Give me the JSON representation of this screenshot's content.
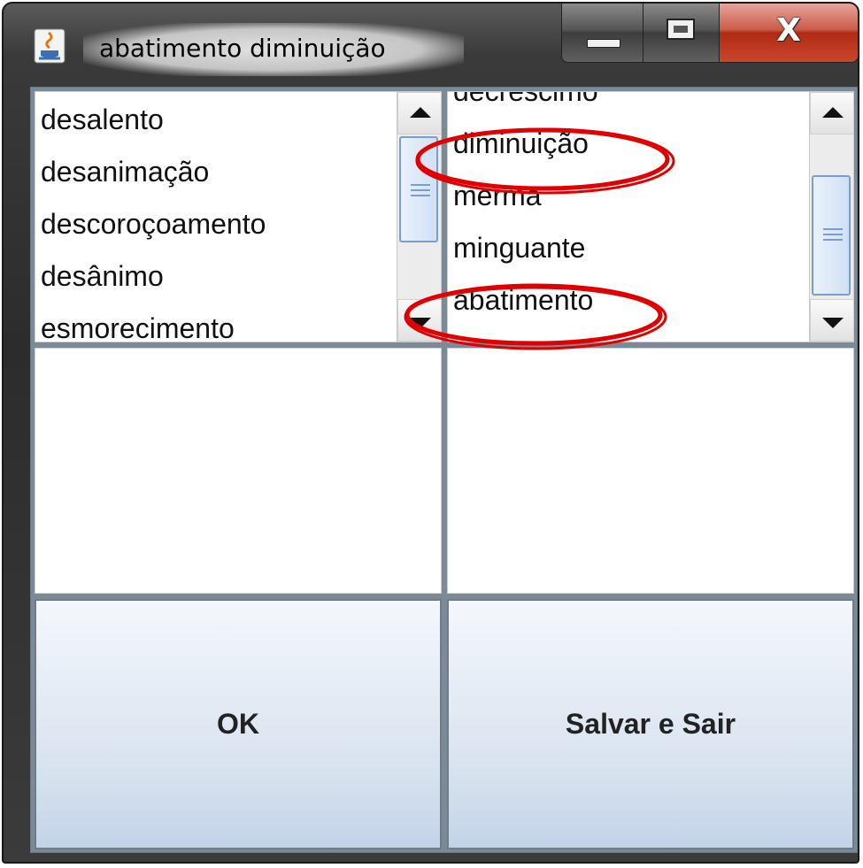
{
  "window": {
    "title": "abatimento diminuição",
    "close_label": "X"
  },
  "left_list": {
    "items": [
      "desalento",
      "desanimação",
      "descoroçoamento",
      "desânimo",
      "esmorecimento"
    ]
  },
  "right_list": {
    "items": [
      "decrescimo",
      "diminuição",
      "merma",
      "minguante",
      "abatimento"
    ],
    "highlighted": [
      "diminuição",
      "abatimento"
    ]
  },
  "buttons": {
    "ok_label": "OK",
    "save_label": "Salvar e Sair"
  },
  "colors": {
    "annotation": "#e00000",
    "close_button": "#c9462c",
    "button_gradient_bottom": "#c3d3e8"
  },
  "icons": {
    "app": "java-coffee-icon",
    "minimize": "minimize-icon",
    "maximize": "maximize-icon",
    "close": "close-icon"
  }
}
